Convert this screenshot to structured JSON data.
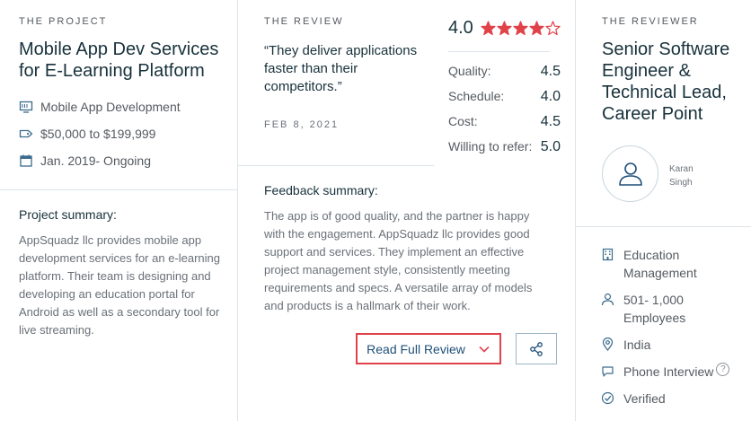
{
  "project": {
    "eyebrow": "THE PROJECT",
    "title_line1": "Mobile App Dev Services",
    "title_line2": "for E-Learning Platform",
    "service": "Mobile App Development",
    "budget": "$50,000 to $199,999",
    "timeline": "Jan. 2019- Ongoing",
    "summary_label": "Project summary:",
    "summary": "AppSquadz llc provides mobile app development services for an e-learning platform. Their team is designing and developing an education portal for Android as well as a secondary tool for live streaming."
  },
  "review": {
    "eyebrow": "THE REVIEW",
    "quote": "“They deliver applications faster than their competitors.”",
    "date": "FEB 8, 2021",
    "overall": "4.0",
    "stars_filled": 4,
    "stars_total": 5,
    "scores": [
      {
        "label": "Quality:",
        "value": "4.5"
      },
      {
        "label": "Schedule:",
        "value": "4.0"
      },
      {
        "label": "Cost:",
        "value": "4.5"
      },
      {
        "label": "Willing to refer:",
        "value": "5.0"
      }
    ],
    "feedback_label": "Feedback summary:",
    "feedback": "The app is of good quality, and the partner is happy with the engagement. AppSquadz llc provides good support and services. They implement an effective project management style, consistently meeting requirements and specs. A versatile array of models and products is a hallmark of their work.",
    "read_more_label": "Read Full Review"
  },
  "reviewer": {
    "eyebrow": "THE REVIEWER",
    "title_line1": "Senior Software",
    "title_line2": "Engineer &",
    "title_line3": "Technical Lead,",
    "title_line4": "Career Point",
    "first_name": "Karan",
    "last_name": "Singh",
    "industry_line1": "Education",
    "industry_line2": "Management",
    "size_line1": "501- 1,000",
    "size_line2": "Employees",
    "location": "India",
    "interview": "Phone Interview",
    "help": "?",
    "verified": "Verified"
  },
  "colors": {
    "star": "#e0424a",
    "accent_border": "#e0424a",
    "link_blue": "#1e4f78",
    "icon_blue": "#3a6b8c"
  },
  "icons": {
    "service": "monitor-icon",
    "budget": "price-tag-icon",
    "timeline": "calendar-icon",
    "chevron": "chevron-down-icon",
    "share": "share-icon",
    "avatar": "user-icon",
    "industry": "building-icon",
    "size": "person-icon",
    "location": "location-pin-icon",
    "interview": "chat-bubble-icon",
    "verified": "check-circle-icon"
  }
}
